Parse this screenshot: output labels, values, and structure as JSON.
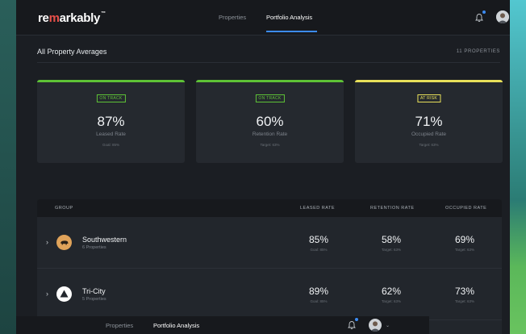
{
  "app": {
    "logo_prefix": "re",
    "logo_mid": "m",
    "logo_suffix": "arkably",
    "logo_tm": "™"
  },
  "nav": {
    "tabs": [
      {
        "label": "Properties"
      },
      {
        "label": "Portfolio Analysis"
      }
    ]
  },
  "section": {
    "title": "All Property Averages",
    "count": "11 PROPERTIES"
  },
  "cards": [
    {
      "status": "ON TRACK",
      "value": "87%",
      "label": "Leased Rate",
      "goal": "Goal: 85%"
    },
    {
      "status": "ON TRACK",
      "value": "60%",
      "label": "Retention Rate",
      "goal": "Target: 63%"
    },
    {
      "status": "AT RISK",
      "value": "71%",
      "label": "Occupied Rate",
      "goal": "Target: 63%"
    }
  ],
  "table": {
    "headers": {
      "group": "GROUP",
      "leased": "LEASED RATE",
      "retention": "RETENTION RATE",
      "occupied": "OCCUPIED RATE"
    },
    "rows": [
      {
        "name": "Southwestern",
        "sub": "6 Properties",
        "leased": "85%",
        "leased_goal": "Goal: 85%",
        "retention": "58%",
        "retention_goal": "Target: 63%",
        "occupied": "69%",
        "occupied_goal": "Target: 63%"
      },
      {
        "name": "Tri-City",
        "sub": "5 Properties",
        "leased": "89%",
        "leased_goal": "Goal: 85%",
        "retention": "62%",
        "retention_goal": "Target: 63%",
        "occupied": "73%",
        "occupied_goal": "Target: 63%"
      }
    ]
  },
  "colors": {
    "on_track": "#5ec236",
    "at_risk": "#e8e05a",
    "accent": "#3c8bf0",
    "row1_icon": "#e0a35a",
    "row2_icon": "#ffffff"
  },
  "icons": {
    "bell": "bell-icon",
    "avatar": "avatar",
    "chevron": "chevron-right-icon"
  }
}
